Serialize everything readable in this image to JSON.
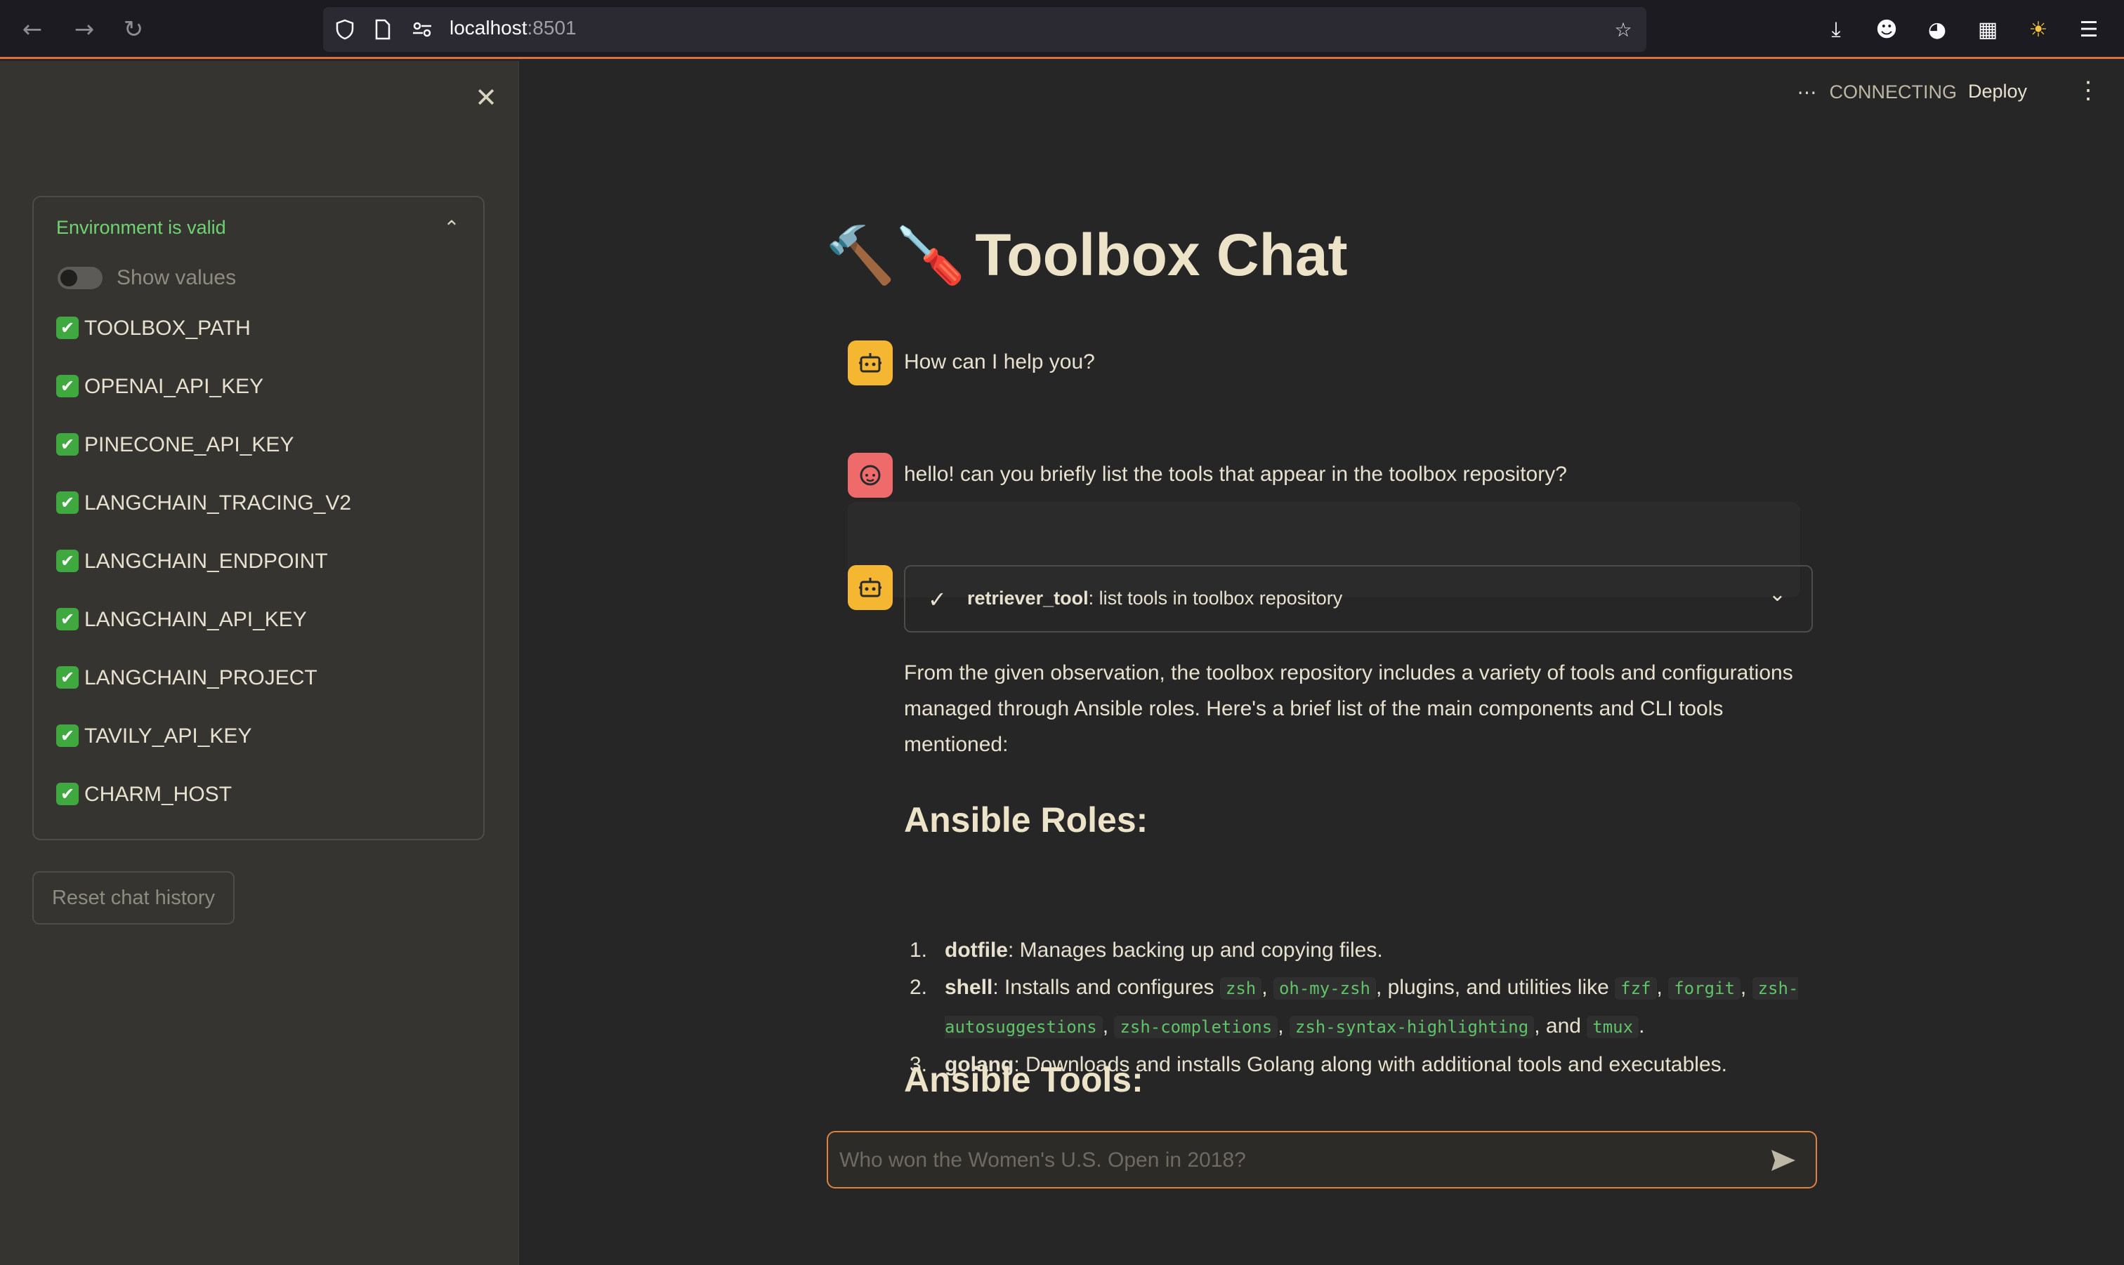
{
  "browser": {
    "url_host": "localhost",
    "url_port": ":8501",
    "icons": [
      "back-icon",
      "forward-icon",
      "reload-icon",
      "shield-icon",
      "page-icon",
      "site-info-icon",
      "bookmark-star-icon",
      "download-icon",
      "account-icon",
      "extension-icon",
      "puzzle-icon",
      "theme-icon",
      "menu-icon"
    ]
  },
  "sidebar": {
    "env_title": "Environment is valid",
    "show_values_label": "Show values",
    "show_values_enabled": false,
    "env_vars": [
      "TOOLBOX_PATH",
      "OPENAI_API_KEY",
      "PINECONE_API_KEY",
      "LANGCHAIN_TRACING_V2",
      "LANGCHAIN_ENDPOINT",
      "LANGCHAIN_API_KEY",
      "LANGCHAIN_PROJECT",
      "TAVILY_API_KEY",
      "CHARM_HOST"
    ],
    "reset_label": "Reset chat history"
  },
  "header": {
    "status": "CONNECTING",
    "deploy": "Deploy"
  },
  "main": {
    "title_emoji": "🔨🪛",
    "title": "Toolbox Chat",
    "greeting": "How can I help you?",
    "user_message": "hello! can you briefly list the tools that appear in the toolbox repository?",
    "tool_name": "retriever_tool",
    "tool_query": ": list tools in toolbox repository",
    "answer_intro": "From the given observation, the toolbox repository includes a variety of tools and configurations managed through Ansible roles. Here's a brief list of the main components and CLI tools mentioned:",
    "roles_heading": "Ansible Roles:",
    "roles": [
      {
        "num": "1.",
        "name": "dotfile",
        "text": ": Manages backing up and copying files."
      },
      {
        "num": "2.",
        "name": "shell",
        "text_a": ": Installs and configures ",
        "code_a": "zsh",
        "sep_a": ",",
        "code_b": "oh-my-zsh",
        "text_b": ", plugins, and utilities like ",
        "code_c": "fzf",
        "sep_b": ",",
        "code_d": "forgit",
        "sep_c": ",",
        "code_e": "zsh-autosuggestions",
        "sep_d": ",",
        "code_f": "zsh-completions",
        "sep_e": ",",
        "code_g": "zsh-syntax-highlighting",
        "text_c": ", and ",
        "code_h": "tmux",
        "text_d": "."
      },
      {
        "num": "3.",
        "name": "golang",
        "text": ": Downloads and installs Golang along with additional tools and executables."
      }
    ],
    "tools_heading": "Ansible Tools:"
  },
  "chat_input": {
    "placeholder": "Who won the Women's U.S. Open in 2018?"
  },
  "colors": {
    "accent": "#e0823f",
    "valid_green": "#6fd36f",
    "bot_avatar": "#f5b731",
    "user_avatar": "#ef6b6b",
    "code_green": "#5fc468"
  }
}
